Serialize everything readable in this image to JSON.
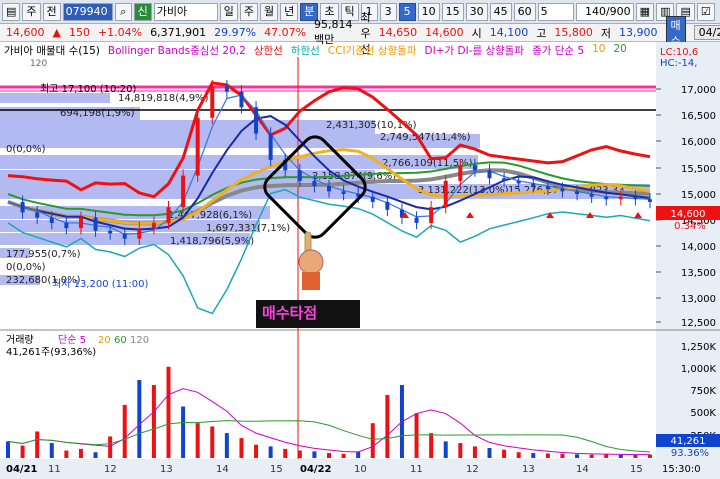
{
  "toolbar": {
    "sidebar_icon": "list-icon",
    "type_label": "주",
    "prev_label": "전",
    "code": "079940",
    "search_icon": "search-icon",
    "badge": "신",
    "name": "가비아",
    "periods": [
      "일",
      "주",
      "월",
      "년",
      "분",
      "초",
      "틱"
    ],
    "active_period": "분",
    "intervals": [
      "1",
      "3",
      "5",
      "10",
      "15",
      "30",
      "45",
      "60"
    ],
    "active_interval": "5",
    "interval_select": "5",
    "pager": "140/900",
    "right_icons": [
      "grid-icon",
      "chart-icon",
      "list-icon",
      "checkbox-icon"
    ]
  },
  "pricebar": {
    "price": "14,600",
    "change_symbol": "▲",
    "change": "150",
    "change_pct": "+1.04%",
    "volume": "6,371,901",
    "rate1": "29.97%",
    "rate2": "47.07%",
    "amount": "95,814백만",
    "quote_label": "최우선",
    "ask": "14,650",
    "bid": "14,600",
    "open_label": "시",
    "open": "14,100",
    "high_label": "고",
    "high": "15,800",
    "low_label": "저",
    "low": "13,900",
    "buy_label": "매수",
    "date": "04/22"
  },
  "legend": {
    "title": "가비아 매물대 수(15)",
    "bb": "Bollinger Bands중심선 20,2",
    "upper": "상한선",
    "lower": "하한선",
    "cci": "CCI기준선 상향돌파",
    "dmi": "DI+가 DI-를 상향돌파",
    "ma": "종가 단순 5",
    "ma10": "10",
    "ma20": "20",
    "lc": "LC:10,6",
    "hc": "HC:-14,",
    "count": "120"
  },
  "annotations": {
    "high_label": "최고 17,100 (10:20)",
    "vol1": "14,819,818(4,9%)",
    "vol2": "694,198(1,9%)",
    "vol3": "0(0,0%)",
    "vol4": "2,431,305(10,1%)",
    "vol5": "2,749,547(11,4%)",
    "vol6": "2,766,109(11,5%)",
    "vol7": "2,158,874(9,6%)",
    "vol8": "3,131,222(13,0%)",
    "range": "15,276,67 ~ 15,023,33",
    "vol9": "1,467,928(6,1%)",
    "vol10": "1,697,331(7,1%)",
    "vol11": "1,418,796(5,9%)",
    "vol12": "177,955(0,7%)",
    "vol13": "0(0,0%)",
    "vol14": "232,680(1,0%)",
    "low_label": "최저 13,200 (11:00)",
    "buy_point": "매수타점",
    "vol_title": "거래량",
    "vol_ma": "단순 5",
    "vol_ma20": "20",
    "vol_ma60": "60",
    "vol_ma120": "120",
    "vol_value": "41,261주(93,36%)"
  },
  "price_axis": [
    "17,000",
    "16,500",
    "16,000",
    "15,500",
    "15,000",
    "14,500",
    "14,000",
    "13,500",
    "13,000",
    "12,500"
  ],
  "price_current": "14,600",
  "price_current_pct": "0.34%",
  "vol_axis": [
    "1,250K",
    "1,000K",
    "750K",
    "500K",
    "250K"
  ],
  "vol_current": "41,261",
  "vol_current_pct": "93.36%",
  "time_axis": [
    "04/21",
    "11",
    "12",
    "13",
    "14",
    "15",
    "04/22",
    "10",
    "11",
    "12",
    "13",
    "14",
    "15"
  ],
  "time_end": "15:30:0",
  "colors": {
    "up": "#e11",
    "down": "#14c",
    "bb_mid": "#e11",
    "ma20": "#f0b020",
    "ma60": "#2a9a2a",
    "ma120": "#888"
  },
  "chart_data": {
    "type": "line",
    "title": "",
    "ylim": [
      12200,
      17300
    ],
    "price": [
      14600,
      14400,
      14300,
      14200,
      14100,
      14300,
      14050,
      14000,
      13900,
      14100,
      14200,
      14500,
      15100,
      16200,
      16800,
      16700,
      16400,
      15900,
      15400,
      15200,
      15000,
      14900,
      14800,
      14750,
      14700,
      14600,
      14450,
      14300,
      14200,
      14500,
      15000,
      15300,
      15200,
      15050,
      15000,
      14950,
      14900,
      14850,
      14800,
      14750,
      14700,
      14650,
      14700,
      14650,
      14600
    ],
    "volume_ylim": [
      0,
      1350000
    ]
  }
}
